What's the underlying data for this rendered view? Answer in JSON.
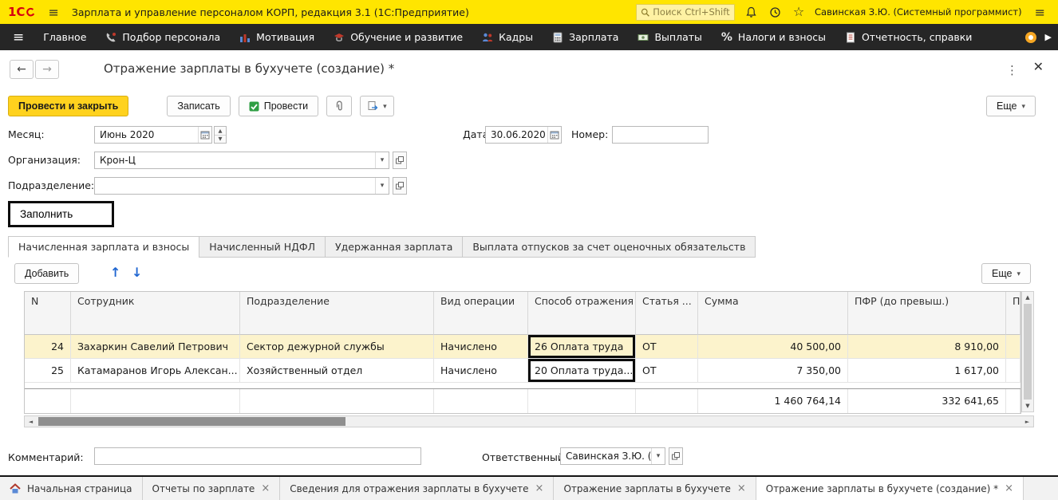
{
  "titlebar": {
    "logo": "1С",
    "title": "Зарплата и управление персоналом КОРП, редакция 3.1 (1С:Предприятие)",
    "search_placeholder": "Поиск Ctrl+Shift+F",
    "user": "Савинская З.Ю. (Системный программист)"
  },
  "menubar": {
    "items": [
      {
        "key": "main",
        "label": "Главное",
        "icon": ""
      },
      {
        "key": "recruiting",
        "label": "Подбор персонала",
        "icon": "phone"
      },
      {
        "key": "motivation",
        "label": "Мотивация",
        "icon": "motivation"
      },
      {
        "key": "training",
        "label": "Обучение и развитие",
        "icon": "education"
      },
      {
        "key": "staff",
        "label": "Кадры",
        "icon": "staff"
      },
      {
        "key": "salary",
        "label": "Зарплата",
        "icon": "salary"
      },
      {
        "key": "payments",
        "label": "Выплаты",
        "icon": "payments"
      },
      {
        "key": "taxes",
        "label": "Налоги и взносы",
        "icon": "taxes"
      },
      {
        "key": "reports",
        "label": "Отчетность, справки",
        "icon": "reports"
      }
    ]
  },
  "page": {
    "title": "Отражение зарплаты в бухучете (создание) *"
  },
  "toolbar": {
    "post_and_close": "Провести и закрыть",
    "write": "Записать",
    "post": "Провести",
    "more": "Еще"
  },
  "form": {
    "month": {
      "label": "Месяц:",
      "value": "Июнь 2020"
    },
    "date": {
      "label": "Дата:",
      "value": "30.06.2020"
    },
    "number": {
      "label": "Номер:",
      "value": ""
    },
    "organization": {
      "label": "Организация:",
      "value": "Крон-Ц"
    },
    "department": {
      "label": "Подразделение:",
      "value": ""
    },
    "fill_button": "Заполнить"
  },
  "tabs": [
    {
      "key": "accrued-salary",
      "label": "Начисленная зарплата и взносы",
      "active": true
    },
    {
      "key": "ndfl",
      "label": "Начисленный НДФЛ",
      "active": false
    },
    {
      "key": "withheld-salary",
      "label": "Удержанная зарплата",
      "active": false
    },
    {
      "key": "vacation-liabilities",
      "label": "Выплата отпусков за счет оценочных обязательств",
      "active": false
    }
  ],
  "table_toolbar": {
    "add": "Добавить",
    "more": "Еще"
  },
  "table": {
    "columns": [
      "N",
      "Сотрудник",
      "Подразделение",
      "Вид операции",
      "Способ отражения",
      "Статья ...",
      "Сумма",
      "ПФР (до превыш.)",
      "По..."
    ],
    "rows": [
      {
        "cells": [
          "24",
          "Захаркин Савелий Петрович",
          "Сектор дежурной службы",
          "Начислено",
          "26 Оплата труда",
          "ОТ",
          "40 500,00",
          "8 910,00",
          ""
        ],
        "selected": true,
        "annotated_cell": 4
      },
      {
        "cells": [
          "25",
          "Катамаранов Игорь Алексан...",
          "Хозяйственный отдел",
          "Начислено",
          "20 Оплата труда...",
          "ОТ",
          "7 350,00",
          "1 617,00",
          ""
        ],
        "selected": false,
        "annotated_cell": 4
      }
    ],
    "totals": [
      "",
      "",
      "",
      "",
      "",
      "",
      "1 460 764,14",
      "332 641,65",
      ""
    ]
  },
  "footer": {
    "comment": {
      "label": "Комментарий:",
      "value": ""
    },
    "responsible": {
      "label": "Ответственный:",
      "value": "Савинская З.Ю. (Систем"
    }
  },
  "bottom_tabs": [
    {
      "key": "home",
      "label": "Начальная страница",
      "icon": "home",
      "closable": false,
      "active": false
    },
    {
      "key": "salary-reports",
      "label": "Отчеты по зарплате",
      "icon": "",
      "closable": true,
      "active": false
    },
    {
      "key": "reflection-info",
      "label": "Сведения для отражения зарплаты в бухучете",
      "icon": "",
      "closable": true,
      "active": false
    },
    {
      "key": "reflection",
      "label": "Отражение зарплаты в бухучете",
      "icon": "",
      "closable": true,
      "active": false
    },
    {
      "key": "reflection-new",
      "label": "Отражение зарплаты в бухучете (создание) *",
      "icon": "",
      "closable": true,
      "active": true
    }
  ]
}
